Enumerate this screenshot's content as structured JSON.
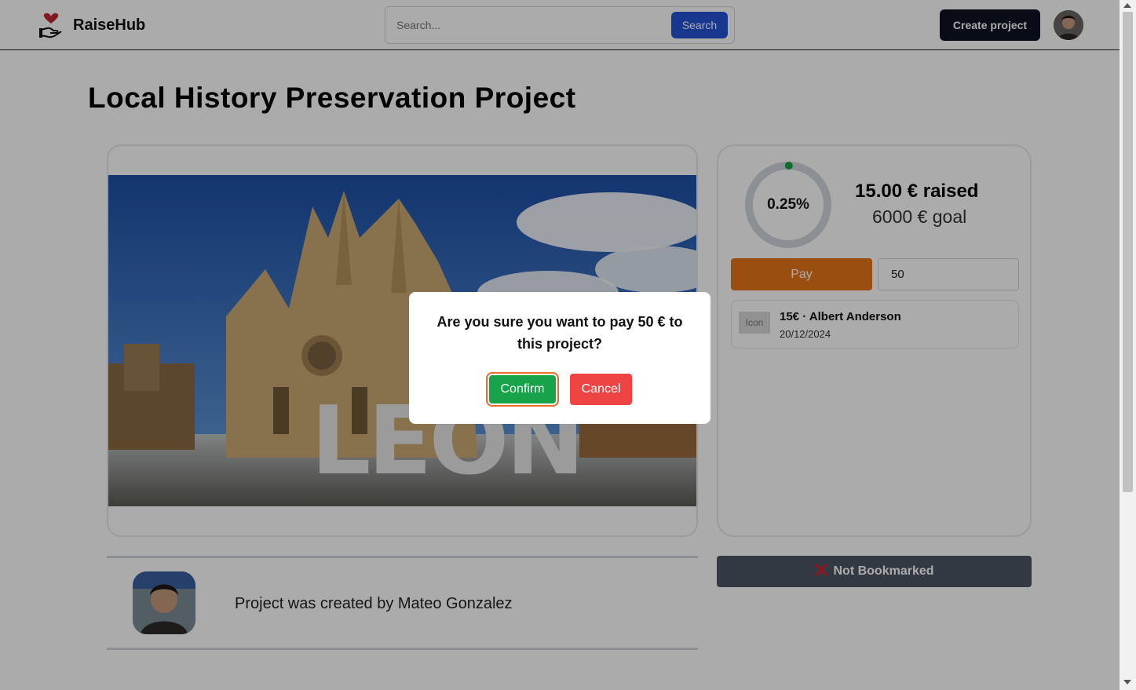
{
  "header": {
    "brand": "RaiseHub",
    "search_placeholder": "Search...",
    "search_button": "Search",
    "create_button": "Create project"
  },
  "project": {
    "title": "Local History Preservation Project",
    "image_alt": "LEON"
  },
  "funding": {
    "percent_label": "0.25%",
    "percent_value": 0.25,
    "raised": "15.00 € raised",
    "goal": "6000 € goal",
    "pay_button": "Pay",
    "amount_value": "50"
  },
  "donations": [
    {
      "icon_label": "Icon",
      "summary": "15€ · Albert Anderson",
      "date": "20/12/2024"
    }
  ],
  "bookmark": {
    "label": "Not Bookmarked",
    "icon": "x-mark-icon"
  },
  "creator": {
    "text": "Project was created by Mateo Gonzalez"
  },
  "modal": {
    "message": "Are you sure you want to pay 50 € to this project?",
    "confirm": "Confirm",
    "cancel": "Cancel"
  },
  "colors": {
    "primary": "#2453d6",
    "pay": "#e6771a",
    "confirm": "#16a34a",
    "cancel": "#ef4444",
    "progress_dot": "#16a34a"
  }
}
